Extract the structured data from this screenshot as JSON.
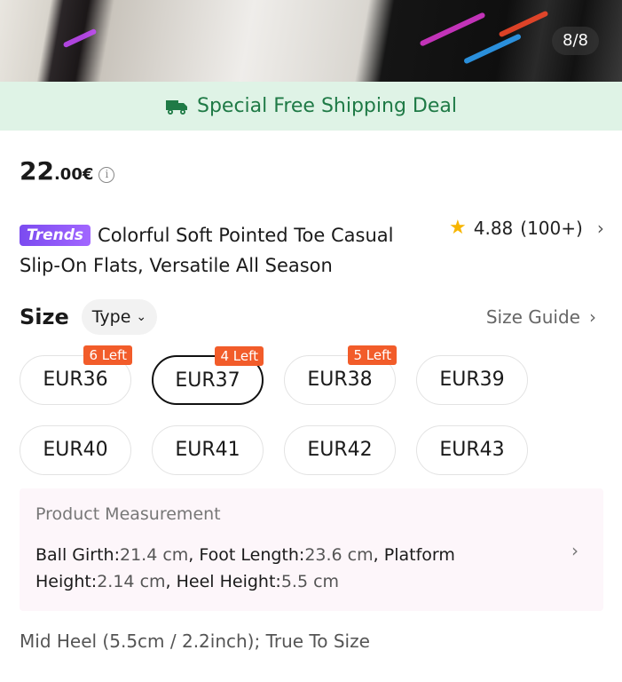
{
  "gallery": {
    "pager": "8/8"
  },
  "shipping_banner": {
    "text": "Special Free Shipping Deal",
    "icon": "truck-icon",
    "color": "#1f7a46",
    "background": "#dff3e6"
  },
  "price": {
    "integer": "22",
    "decimal": ".00€",
    "info_icon": "info-icon"
  },
  "product": {
    "badge": "Trends",
    "title": "Colorful Soft Pointed Toe Casual Slip-On Flats, Versatile All Season"
  },
  "rating": {
    "score": "4.88",
    "count": "(100+)",
    "icon": "star-icon"
  },
  "size": {
    "label": "Size",
    "type_label": "Type",
    "guide_label": "Size Guide",
    "options": [
      {
        "label": "EUR36",
        "stock": "6 Left",
        "selected": false
      },
      {
        "label": "EUR37",
        "stock": "4 Left",
        "selected": true
      },
      {
        "label": "EUR38",
        "stock": "5 Left",
        "selected": false
      },
      {
        "label": "EUR39",
        "stock": "",
        "selected": false
      },
      {
        "label": "EUR40",
        "stock": "",
        "selected": false
      },
      {
        "label": "EUR41",
        "stock": "",
        "selected": false
      },
      {
        "label": "EUR42",
        "stock": "",
        "selected": false
      },
      {
        "label": "EUR43",
        "stock": "",
        "selected": false
      }
    ]
  },
  "measurement": {
    "title": "Product Measurement",
    "ball_girth_label": "Ball Girth:",
    "ball_girth_value": "21.4 cm",
    "foot_length_label": "Foot Length:",
    "foot_length_value": "23.6 cm",
    "platform_height_label": "Platform Height:",
    "platform_height_value": "2.14 cm",
    "heel_height_label": "Heel Height:",
    "heel_height_value": "5.5 cm"
  },
  "footnote": "Mid Heel (5.5cm / 2.2inch); True To Size",
  "colors": {
    "accent_stock": "#f25c2a",
    "star": "#f7b500",
    "trends_badge": "#7b4bf0"
  }
}
